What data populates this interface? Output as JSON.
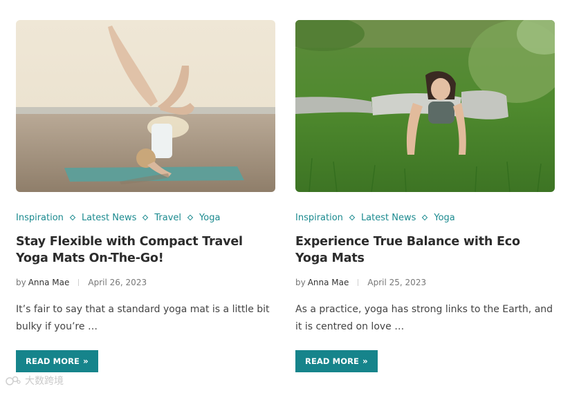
{
  "posts": [
    {
      "image_alt": "Woman doing a headstand on a yoga mat on the beach",
      "categories": [
        "Inspiration",
        "Latest News",
        "Travel",
        "Yoga"
      ],
      "title": "Stay Flexible with Compact Travel Yoga Mats On-The-Go!",
      "by": "by",
      "author": "Anna Mae",
      "date": "April 26, 2023",
      "excerpt": "It’s fair to say that a standard yoga mat is a little bit bulky if you’re …",
      "read_more": "READ MORE"
    },
    {
      "image_alt": "Woman doing a yoga pose on grass outdoors",
      "categories": [
        "Inspiration",
        "Latest News",
        "Yoga"
      ],
      "title": "Experience True Balance with Eco Yoga Mats",
      "by": "by",
      "author": "Anna Mae",
      "date": "April 25, 2023",
      "excerpt": "As a practice, yoga has strong links to the Earth, and it is centred on love …",
      "read_more": "READ MORE"
    }
  ],
  "watermark": "大数跨境",
  "colors": {
    "accent": "#16848b",
    "category": "#1b8a8f",
    "title": "#2c2c2c"
  }
}
